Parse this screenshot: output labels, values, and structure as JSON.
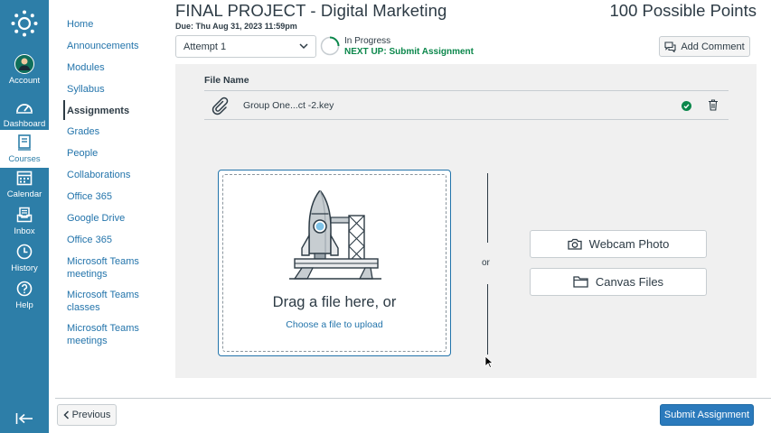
{
  "global_nav": {
    "items": [
      {
        "label": "Account",
        "icon": "avatar"
      },
      {
        "label": "Dashboard",
        "icon": "dashboard-icon"
      },
      {
        "label": "Courses",
        "icon": "courses-icon"
      },
      {
        "label": "Calendar",
        "icon": "calendar-icon"
      },
      {
        "label": "Inbox",
        "icon": "inbox-icon"
      },
      {
        "label": "History",
        "icon": "history-icon"
      },
      {
        "label": "Help",
        "icon": "help-icon"
      }
    ],
    "active": "Courses",
    "color": "#2d7ea8"
  },
  "course_nav": {
    "items": [
      "Home",
      "Announcements",
      "Modules",
      "Syllabus",
      "Assignments",
      "Grades",
      "People",
      "Collaborations",
      "Office 365",
      "Google Drive",
      "Office 365",
      "Microsoft Teams meetings",
      "Microsoft Teams classes",
      "Microsoft Teams meetings"
    ],
    "active": "Assignments"
  },
  "assignment": {
    "title": "FINAL PROJECT - Digital Marketing",
    "due": "Due: Thu Aug 31, 2023 11:59pm",
    "points": "100 Possible Points"
  },
  "attempt": {
    "selected": "Attempt 1",
    "status": "In Progress",
    "next_up": "NEXT UP: Submit Assignment"
  },
  "toolbar": {
    "add_comment": "Add Comment"
  },
  "files": {
    "header": "File Name",
    "rows": [
      {
        "name": "Group One...ct -2.key"
      }
    ]
  },
  "upload": {
    "drop_title": "Drag a file here, or",
    "drop_link": "Choose a file to upload",
    "or": "or",
    "webcam": "Webcam Photo",
    "canvas_files": "Canvas Files"
  },
  "footer": {
    "previous": "Previous",
    "submit": "Submit Assignment"
  }
}
